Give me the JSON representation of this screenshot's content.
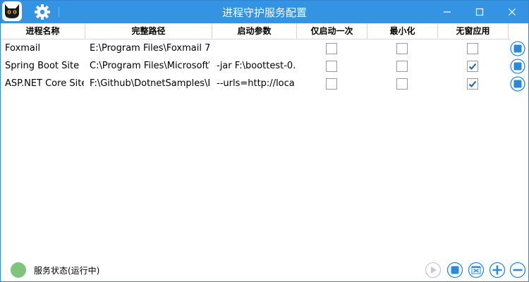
{
  "window": {
    "title": "进程守护服务配置"
  },
  "table": {
    "columns": [
      "进程名称",
      "完整路径",
      "启动参数",
      "仅启动一次",
      "最小化",
      "无窗应用"
    ],
    "rows": [
      {
        "name": "Foxmail",
        "path": "E:\\Program Files\\Foxmail 7.",
        "args": "",
        "run_once": false,
        "minimized": false,
        "no_window": false
      },
      {
        "name": "Spring Boot Site",
        "path": "C:\\Program Files\\Microsoft\\",
        "args": "-jar F:\\boottest-0.",
        "run_once": false,
        "minimized": false,
        "no_window": true
      },
      {
        "name": "ASP.NET Core Site",
        "path": "F:\\Github\\DotnetSamples\\D",
        "args": "--urls=http://loca",
        "run_once": false,
        "minimized": false,
        "no_window": true
      }
    ]
  },
  "footer": {
    "status_text": "服务状态(运行中)",
    "status_color": "#7fc47d"
  },
  "colors": {
    "accent": "#3493e3",
    "icon_blue": "#2a8ad8"
  },
  "icons": {
    "logo": "cat-logo-icon",
    "settings": "gear-icon",
    "minimize": "minimize-icon",
    "maximize": "maximize-icon",
    "close": "close-icon",
    "row_stop": "stop-icon",
    "play": "play-icon",
    "stop": "stop-icon",
    "log": "log-window-icon",
    "add": "plus-icon",
    "remove": "minus-icon"
  }
}
